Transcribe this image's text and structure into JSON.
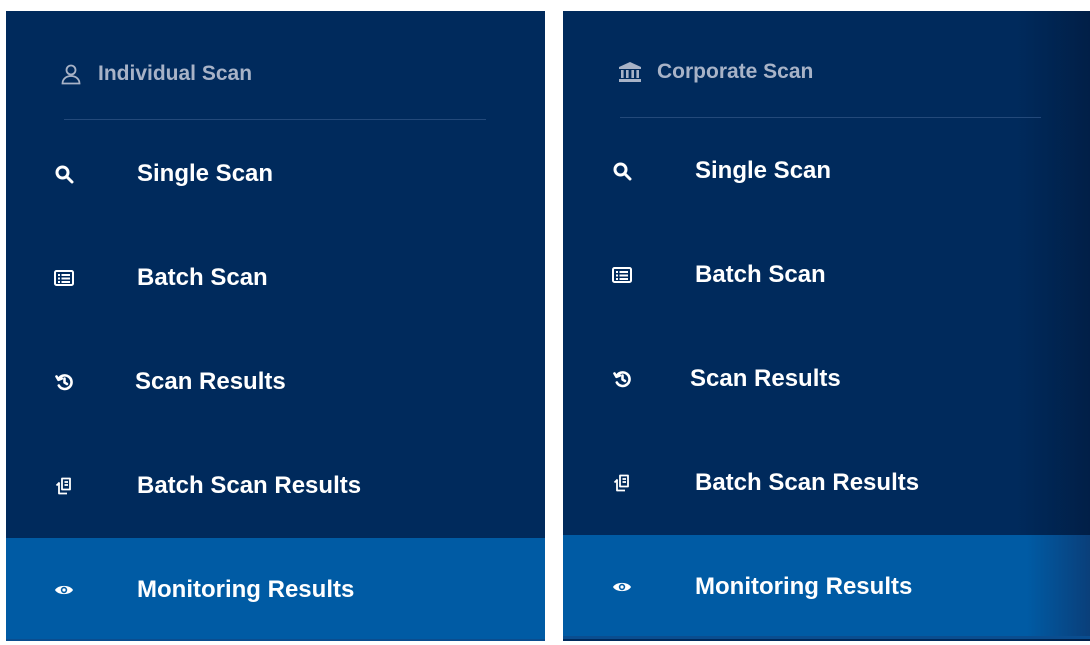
{
  "left_panel": {
    "header": {
      "label": "Individual Scan",
      "icon": "user-icon"
    },
    "items": [
      {
        "label": "Single Scan",
        "icon": "search-icon",
        "active": false
      },
      {
        "label": "Batch Scan",
        "icon": "list-icon",
        "active": false
      },
      {
        "label": "Scan Results",
        "icon": "history-icon",
        "active": false
      },
      {
        "label": "Batch Scan Results",
        "icon": "documents-icon",
        "active": false
      },
      {
        "label": "Monitoring Results",
        "icon": "eye-icon",
        "active": true
      }
    ]
  },
  "right_panel": {
    "header": {
      "label": "Corporate Scan",
      "icon": "bank-icon"
    },
    "items": [
      {
        "label": "Single Scan",
        "icon": "search-icon",
        "active": false
      },
      {
        "label": "Batch Scan",
        "icon": "list-icon",
        "active": false
      },
      {
        "label": "Scan Results",
        "icon": "history-icon",
        "active": false
      },
      {
        "label": "Batch Scan Results",
        "icon": "documents-icon",
        "active": false
      },
      {
        "label": "Monitoring Results",
        "icon": "eye-icon",
        "active": true
      }
    ]
  },
  "colors": {
    "panel_bg": "#002a5c",
    "active_bg": "#005ba4",
    "header_text": "#a8b3c7",
    "item_text": "#ffffff"
  }
}
